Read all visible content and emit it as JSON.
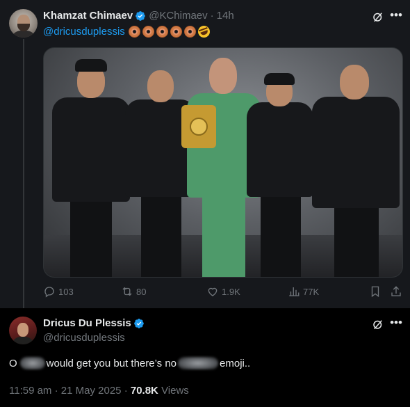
{
  "tweet1": {
    "author_name": "Khamzat Chimaev",
    "author_handle": "@KChimaev",
    "separator": "·",
    "time": "14h",
    "mention": "@dricusduplessis",
    "emoji_names": [
      "doughnut",
      "doughnut",
      "doughnut",
      "doughnut",
      "doughnut",
      "rolling-on-floor-laughing"
    ],
    "stats": {
      "replies": "103",
      "reposts": "80",
      "likes": "1.9K",
      "views": "77K"
    }
  },
  "reply": {
    "author_name": "Dricus Du Plessis",
    "author_handle": "@dricusduplessis",
    "text_part1": "O",
    "text_part2": "would get you but there’s no",
    "text_part3": "emoji..",
    "time": "11:59 am",
    "date": "21 May 2025",
    "views_count": "70.8K",
    "views_label": "Views"
  },
  "colors": {
    "background": "#000000",
    "card_background": "#16181c",
    "link_blue": "#1d9bf0",
    "muted_gray": "#71767b",
    "text": "#e7e9ea",
    "verified_blue": "#1d9bf0"
  }
}
